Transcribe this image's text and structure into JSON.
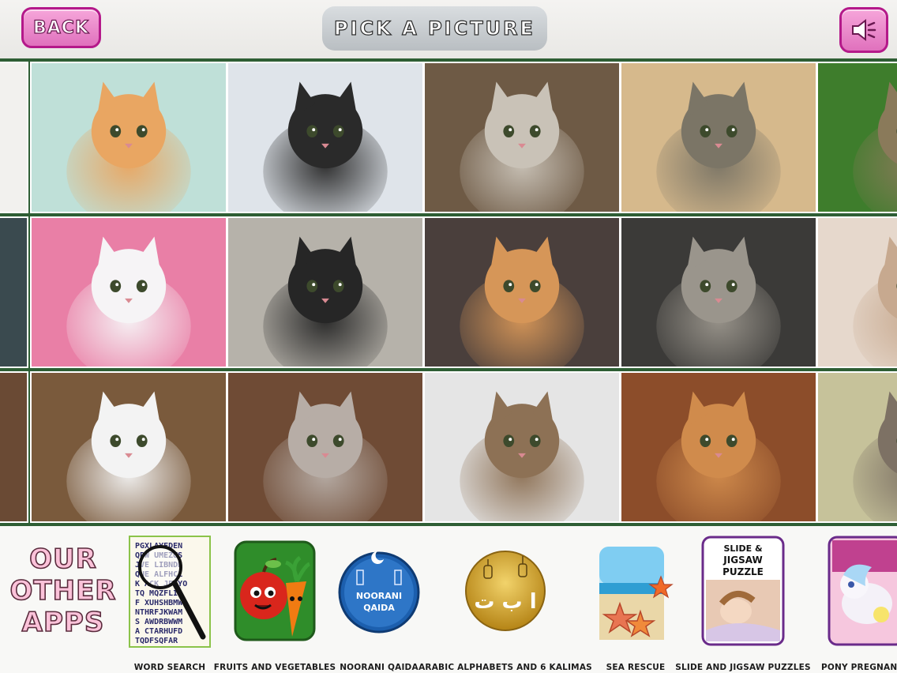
{
  "header": {
    "back_label": "BACK",
    "title": "PICK A PICTURE",
    "sound_icon": "speaker-icon",
    "accent_color": "#e071bd"
  },
  "grid": {
    "frame_color": "#2e5e34",
    "pictures": [
      {
        "name": "kitten-cream-partial",
        "colors": [
          "#f2f1ee",
          "#e6a86e"
        ]
      },
      {
        "name": "kitten-orange-white",
        "colors": [
          "#bfe0d8",
          "#e9a662"
        ]
      },
      {
        "name": "kitten-black-white",
        "colors": [
          "#dfe4ea",
          "#2a2a2a"
        ]
      },
      {
        "name": "four-kittens-on-wood",
        "colors": [
          "#6e5a45",
          "#c9c2b7"
        ]
      },
      {
        "name": "grey-cat-in-bag",
        "colors": [
          "#d6b98c",
          "#7b7566"
        ]
      },
      {
        "name": "tabby-in-grass-partial",
        "colors": [
          "#3e7d2c",
          "#8a7a5a"
        ]
      },
      {
        "name": "cat-window-partial",
        "colors": [
          "#3a4a4f",
          "#7c8b90"
        ]
      },
      {
        "name": "white-kittens-pink-flowers",
        "colors": [
          "#e97fa6",
          "#f6f4f6"
        ]
      },
      {
        "name": "tuxedo-cat-room",
        "colors": [
          "#b6b2aa",
          "#262626"
        ]
      },
      {
        "name": "ginger-cat-closeup",
        "colors": [
          "#4a3f3c",
          "#d69658"
        ]
      },
      {
        "name": "grey-tabby-looking-up",
        "colors": [
          "#3b3a38",
          "#9a958c"
        ]
      },
      {
        "name": "cat-beige-partial",
        "colors": [
          "#e6d8cc",
          "#c7a98f"
        ]
      },
      {
        "name": "basket-partial",
        "colors": [
          "#6a4a34",
          "#b89a77"
        ]
      },
      {
        "name": "white-kitten-blue-eyes",
        "colors": [
          "#7a5a3c",
          "#f3f3f3"
        ]
      },
      {
        "name": "sphynx-cat-stairs",
        "colors": [
          "#6f4b35",
          "#b7ada6"
        ]
      },
      {
        "name": "tabby-cat-lying",
        "colors": [
          "#e5e5e5",
          "#8d7155"
        ]
      },
      {
        "name": "orange-tabby-lying",
        "colors": [
          "#8c4d2a",
          "#d08b4c"
        ]
      },
      {
        "name": "tabby-kitten-partial",
        "colors": [
          "#c6c29a",
          "#7d7164"
        ]
      }
    ]
  },
  "apps": {
    "heading_lines": [
      "OUR",
      "OTHER",
      "APPS"
    ],
    "items": [
      {
        "label": "WORD SEARCH",
        "icon": "word-search-icon"
      },
      {
        "label": "FRUITS AND VEGETABLES",
        "icon": "apple-carrot-icon"
      },
      {
        "label": "NOORANI QAIDA",
        "icon": "noorani-qaida-icon",
        "icon_text": "NOORANI QAIDA"
      },
      {
        "label": "ARABIC ALPHABETS AND 6 KALIMAS",
        "icon": "arabic-lanterns-icon",
        "icon_text": "ا ب ت"
      },
      {
        "label": "SEA RESCUE",
        "icon": "starfish-beach-icon"
      },
      {
        "label": "SLIDE AND JIGSAW PUZZLES",
        "icon": "jigsaw-puzzle-icon",
        "icon_text": "SLIDE & JIGSAW PUZZLE"
      },
      {
        "label": "PONY PREGNANCY",
        "icon": "pony-icon"
      }
    ],
    "word_search_rows": [
      "PGXLAYEDEN",
      "QPW UMEZUS",
      "JVE LIBNDB",
      "QUE ALFHCL",
      "K ACK JPSYO",
      "TQ MQZFLIS",
      "F XUHSHBMW",
      "NTHRFJKWAM",
      "S AWDRBWWM",
      "A CTARHUFD",
      "TQDFSQFAR"
    ]
  }
}
